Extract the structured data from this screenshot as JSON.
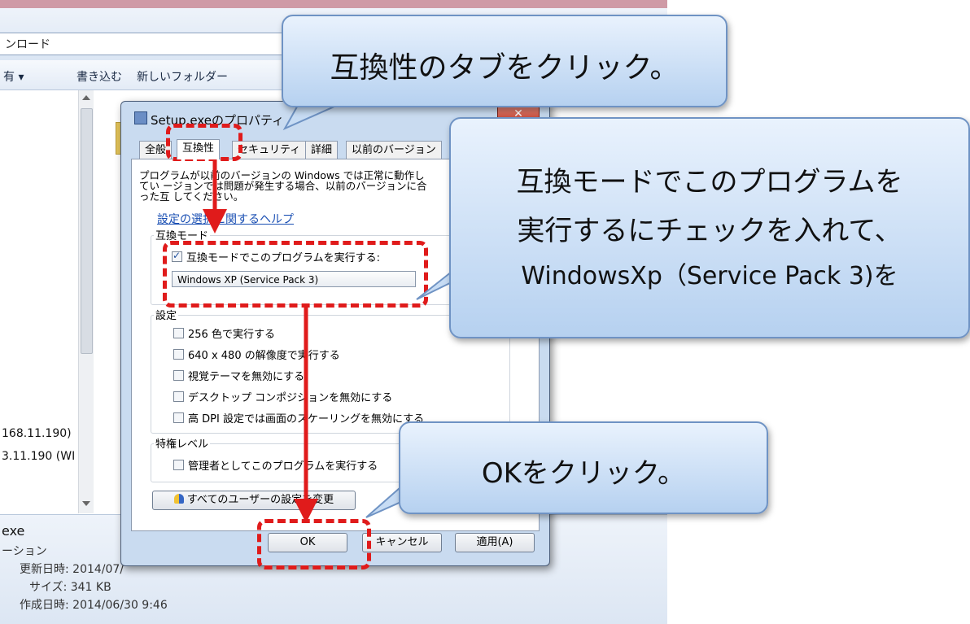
{
  "explorer": {
    "address_text": "ンロード",
    "toolbar": [
      "有 ▾",
      "書き込む",
      "新しいフォルダー"
    ],
    "ip_lines": [
      "168.11.190)",
      "3.11.190 (WI"
    ],
    "details": {
      "filename": "exe",
      "type": "ーション",
      "modified": "更新日時: 2014/07/",
      "size": "サイズ: 341 KB",
      "created": "作成日時: 2014/06/30 9:46"
    }
  },
  "dialog": {
    "title": "Setup.exeのプロパティ",
    "close_label": "✕",
    "tabs": [
      "全般",
      "互換性",
      "セキュリティ",
      "詳細",
      "以前のバージョン"
    ],
    "description": "プログラムが以前のバージョンの Windows では正常に動作してい ージョンでは問題が発生する場合、以前のバージョンに合った互 してください。",
    "help_link": "設定の選択に関するヘルプ",
    "compat_mode_label": "互換モード",
    "compat_checkbox": "互換モードでこのプログラムを実行する:",
    "compat_select": "Windows XP (Service Pack 3)",
    "settings_label": "設定",
    "settings": [
      "256 色で実行する",
      "640 x 480 の解像度で実行する",
      "視覚テーマを無効にする",
      "デスクトップ コンポジションを無効にする",
      "高 DPI 設定では画面のスケーリングを無効にする"
    ],
    "privilege_label": "特権レベル",
    "privilege_checkbox": "管理者としてこのプログラムを実行する",
    "change_all_users": "すべてのユーザーの設定を変更",
    "buttons": {
      "ok": "OK",
      "cancel": "キャンセル",
      "apply": "適用(A)"
    }
  },
  "annotations": {
    "callout_tab": "互換性のタブをクリック。",
    "callout_compat": [
      "互換モードでこのプログラムを",
      "実行するにチェックを入れて、",
      "WindowsXp（Service Pack 3)を"
    ],
    "callout_ok": "OKをクリック。",
    "highlight_color": "#e01b1b",
    "callout_color": "#b6d1f0"
  }
}
